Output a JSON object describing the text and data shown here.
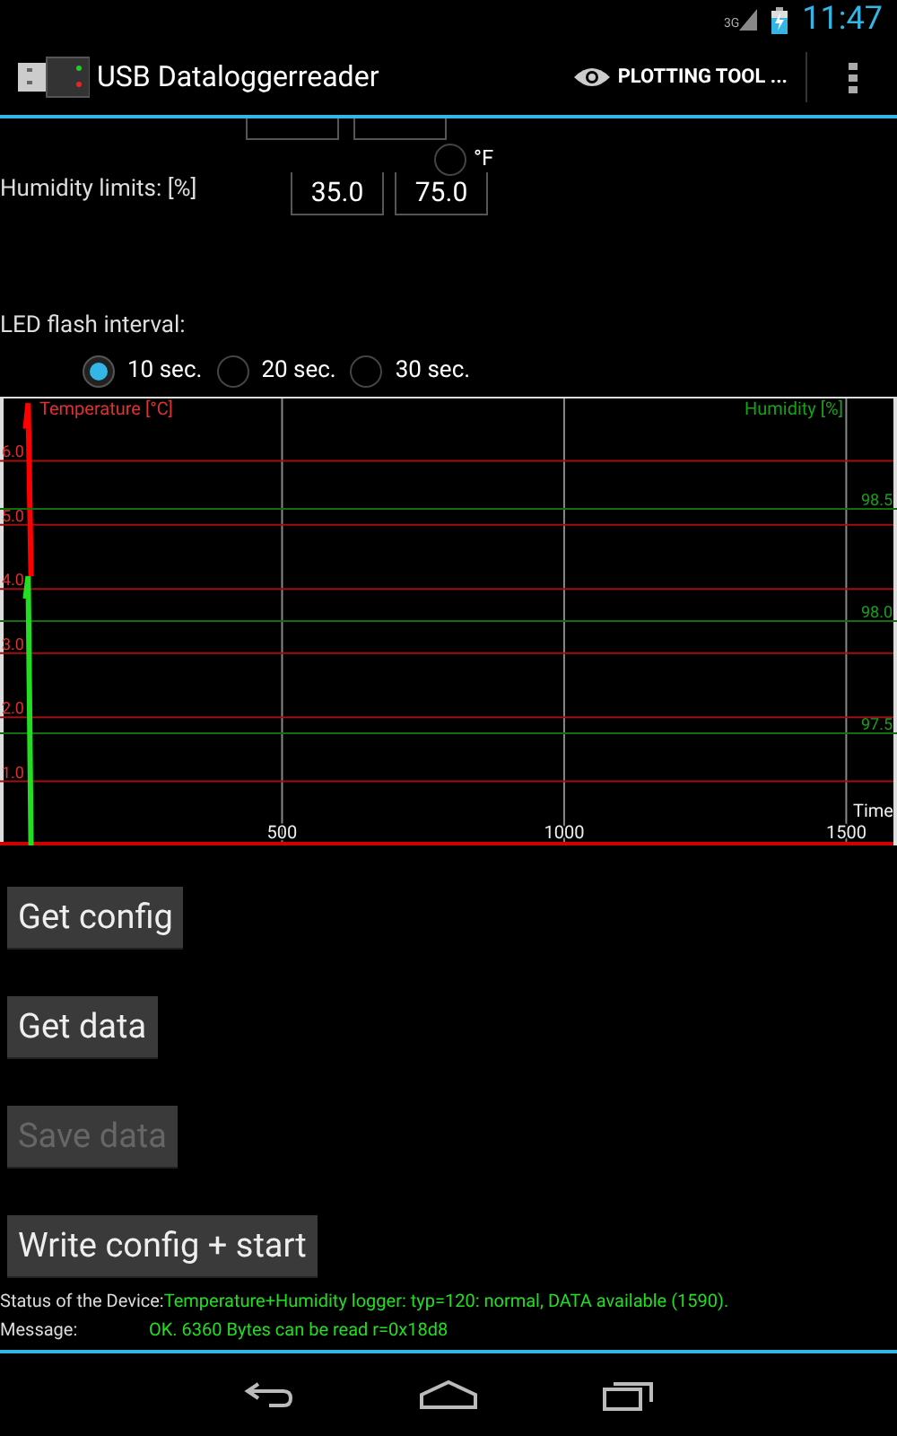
{
  "status_bar": {
    "network": "3G",
    "time": "11:47"
  },
  "action_bar": {
    "title": "USB Dataloggerreader",
    "action": "PLOTTING TOOL ..."
  },
  "humidity_limits": {
    "label": "Humidity limits: [%]",
    "min": "35.0",
    "max": "75.0"
  },
  "unit_option": {
    "label": "°F",
    "selected": false
  },
  "led_interval": {
    "label": "LED flash interval:",
    "options": [
      {
        "label": "10 sec.",
        "selected": true
      },
      {
        "label": "20 sec.",
        "selected": false
      },
      {
        "label": "30 sec.",
        "selected": false
      }
    ]
  },
  "plots": [
    {
      "chart_data": {
        "type": "line",
        "grid": true,
        "xlabel": "Time",
        "xlim": [
          0,
          1590
        ],
        "ylim": [
          0,
          7
        ],
        "xticks": [
          500,
          1000,
          1500
        ],
        "yticks": [
          {
            "value": 1,
            "label": "1.0"
          },
          {
            "value": 2,
            "label": "2.0"
          },
          {
            "value": 3,
            "label": "3.0"
          },
          {
            "value": 4,
            "label": "4.0"
          },
          {
            "value": 5,
            "label": "5.0"
          },
          {
            "value": 6,
            "label": "6.0"
          }
        ],
        "series": [
          {
            "name": "Temperature [°C]",
            "color": "#ff0000",
            "x": [
              45,
              50,
              55
            ],
            "values": [
              6.5,
              6.9,
              4.2
            ]
          }
        ]
      }
    },
    {
      "chart_data": {
        "type": "line",
        "grid": true,
        "xlim": [
          0,
          1590
        ],
        "ylim": [
          97,
          99
        ],
        "yticks": [
          {
            "value": 97.5,
            "label": "97.5"
          },
          {
            "value": 98,
            "label": "98.0"
          },
          {
            "value": 98.5,
            "label": "98.5"
          }
        ],
        "series": [
          {
            "name": "Humidity [%]",
            "color": "#22dd22",
            "x": [
              45,
              50,
              55
            ],
            "values": [
              98.1,
              98.2,
              97.0
            ]
          }
        ]
      }
    }
  ],
  "buttons": [
    {
      "label": "Get config",
      "disabled": false
    },
    {
      "label": "Get data",
      "disabled": false
    },
    {
      "label": "Save data",
      "disabled": true
    },
    {
      "label": "Write config + start",
      "disabled": false
    }
  ],
  "status": {
    "label": "Status of the Device:",
    "value": "Temperature+Humidity logger: typ=120: normal, DATA available (1590)."
  },
  "message": {
    "label": "Message:",
    "value": "OK. 6360 Bytes can be read r=0x18d8"
  }
}
